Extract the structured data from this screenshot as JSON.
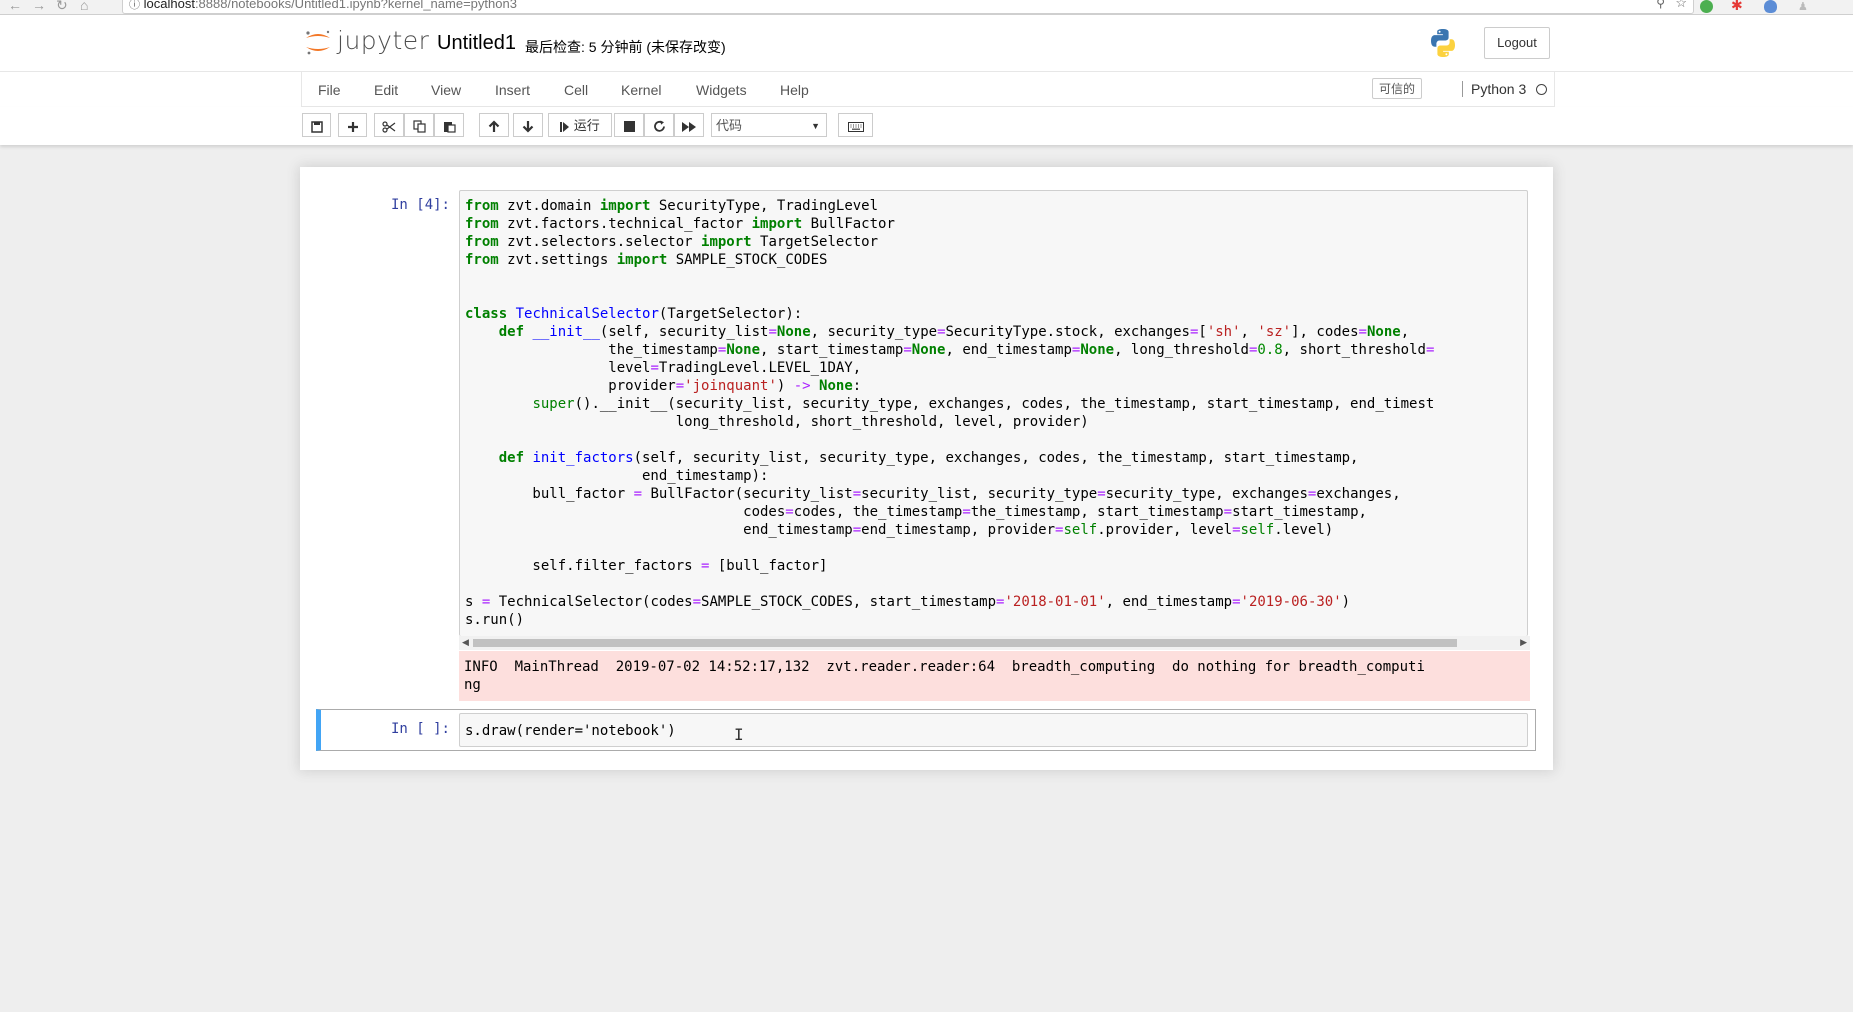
{
  "browser": {
    "url_host": "localhost",
    "url_rest": ":8888/notebooks/Untitled1.ipynb?kernel_name=python3"
  },
  "header": {
    "logo_text": "jupyter",
    "notebook_name": "Untitled1",
    "checkpoint": "最后检查: 5 分钟前  (未保存改变)",
    "logout_label": "Logout"
  },
  "menu": {
    "items": [
      "File",
      "Edit",
      "View",
      "Insert",
      "Cell",
      "Kernel",
      "Widgets",
      "Help"
    ],
    "trusted_label": "可信的",
    "kernel_name": "Python 3"
  },
  "toolbar": {
    "run_label": "运行",
    "cell_type": "代码"
  },
  "cells": {
    "cell1_prompt": "In [4]:",
    "cell2_prompt": "In [ ]:",
    "output_text": "INFO  MainThread  2019-07-02 14:52:17,132  zvt.reader.reader:64  breadth_computing  do nothing for breadth_computi\nng",
    "cell2_code": "s.draw(render='notebook')"
  },
  "colors": {
    "accent_blue": "#42a5f5",
    "prompt_blue": "#303f9f",
    "output_error_bg": "#fddfdd",
    "keyword_green": "#008000",
    "string_red": "#ba2121"
  }
}
